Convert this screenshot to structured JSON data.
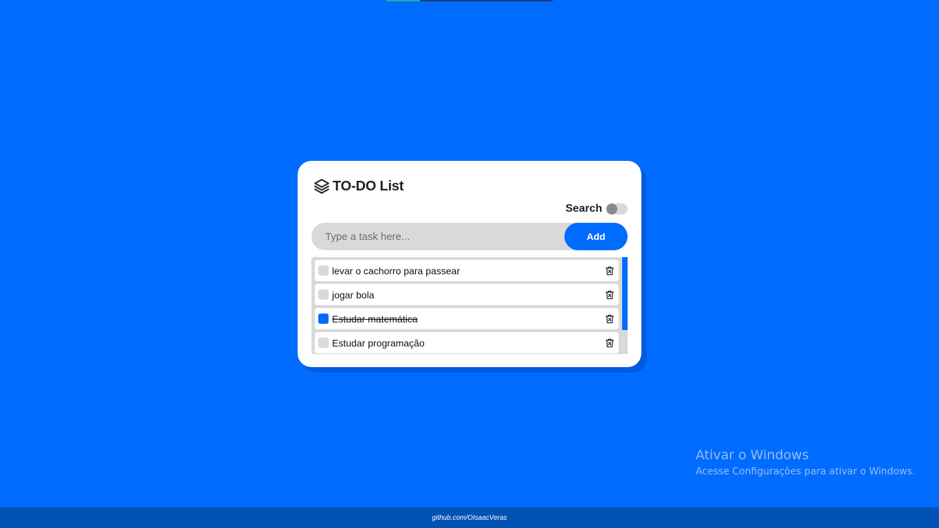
{
  "app": {
    "title": "TO-DO List",
    "icon": "layers-icon"
  },
  "search": {
    "label": "Search",
    "enabled": false
  },
  "task_input": {
    "placeholder": "Type a task here...",
    "value": ""
  },
  "add_button": {
    "label": "Add"
  },
  "tasks": [
    {
      "label": "levar o cachorro para passear",
      "done": false
    },
    {
      "label": "jogar bola",
      "done": false
    },
    {
      "label": "Estudar matemática",
      "done": true
    },
    {
      "label": "Estudar programação",
      "done": false
    }
  ],
  "watermark": {
    "title": "Ativar o Windows",
    "subtitle": "Acesse Configurações para ativar o Windows."
  },
  "footer": {
    "link": "github.com/OIsaacVeras"
  },
  "colors": {
    "background": "#006cff",
    "accent": "#006cff",
    "footer": "#0052b4"
  }
}
